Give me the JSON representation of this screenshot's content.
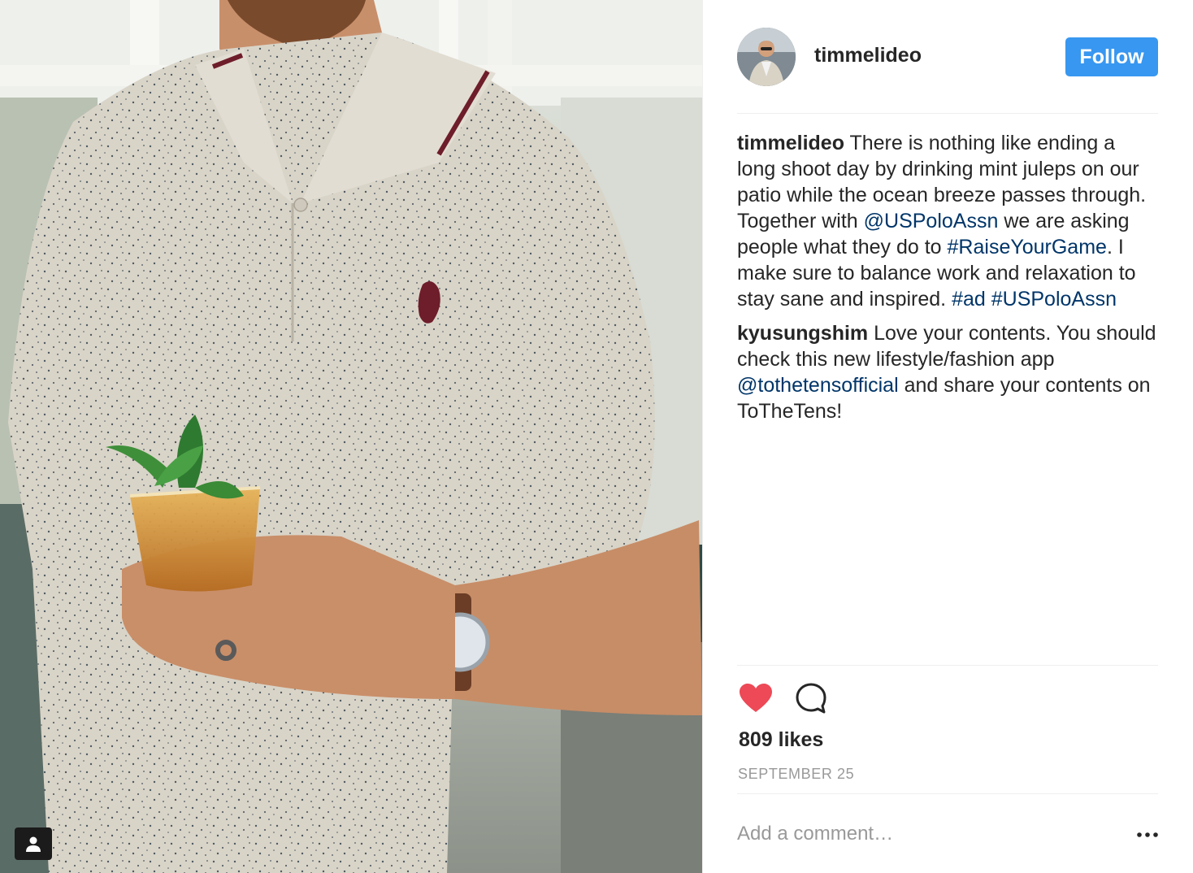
{
  "post": {
    "username": "timmelideo",
    "follow_label": "Follow",
    "comments": [
      {
        "author": "timmelideo",
        "segments": [
          {
            "text": " There is nothing like ending a long shoot day by drinking mint juleps on our patio while the ocean breeze passes through. Together with ",
            "link": false
          },
          {
            "text": "@USPoloAssn",
            "link": true
          },
          {
            "text": " we are asking people what they do to ",
            "link": false
          },
          {
            "text": "#RaiseYourGame",
            "link": true
          },
          {
            "text": ". I make sure to balance work and relaxation to stay sane and inspired. ",
            "link": false
          },
          {
            "text": "#ad",
            "link": true
          },
          {
            "text": " ",
            "link": false
          },
          {
            "text": "#USPoloAssn",
            "link": true
          }
        ]
      },
      {
        "author": "kyusungshim",
        "segments": [
          {
            "text": " Love your contents. You should check this new lifestyle/fashion app ",
            "link": false
          },
          {
            "text": "@tothetensofficial",
            "link": true
          },
          {
            "text": " and share your contents on ToTheTens!",
            "link": false
          }
        ]
      }
    ],
    "likes": "809 likes",
    "date": "SEPTEMBER 25",
    "add_comment_placeholder": "Add a comment…",
    "liked": true
  },
  "icons": {
    "like": "heart-icon",
    "comment": "comment-icon",
    "more": "more-options-icon",
    "tag": "user-tag-icon"
  },
  "colors": {
    "follow_button": "#3897f0",
    "heart": "#ed4956",
    "link": "#003569",
    "text": "#262626",
    "muted": "#999999"
  }
}
